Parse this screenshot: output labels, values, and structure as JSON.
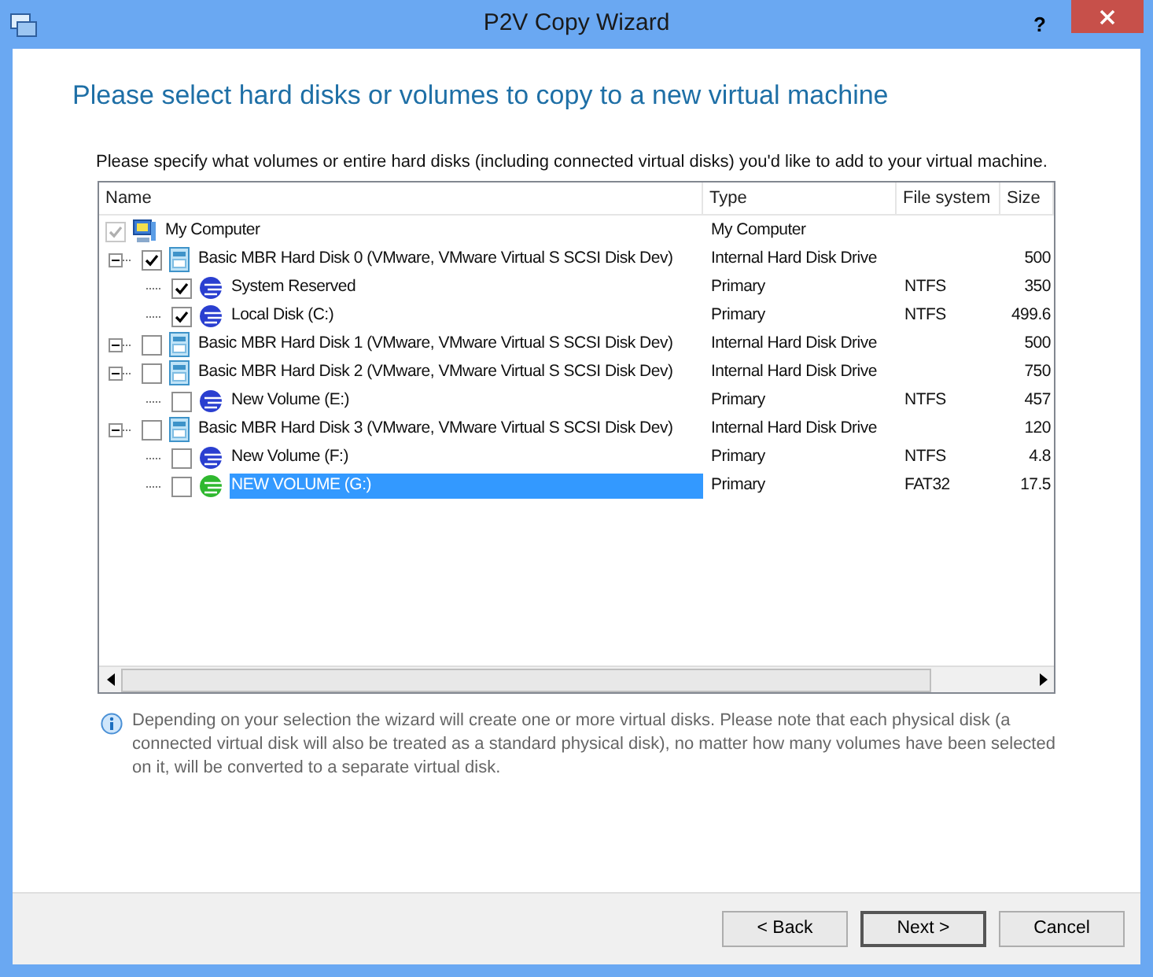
{
  "window": {
    "title": "P2V Copy Wizard",
    "help": "?"
  },
  "heading": "Please select hard disks or volumes to copy to a new virtual machine",
  "instruction": "Please specify what volumes or entire hard disks (including connected virtual disks) you'd like to add to your virtual machine.",
  "table": {
    "columns": [
      "Name",
      "Type",
      "File system",
      "Size"
    ],
    "rows": [
      {
        "kind": "computer",
        "name": "My Computer",
        "type": "My Computer",
        "checked": true,
        "disabled": true,
        "selected": false,
        "children": [
          {
            "kind": "disk",
            "name": "Basic MBR Hard Disk 0 (VMware, VMware Virtual S SCSI Disk Dev)",
            "type": "Internal Hard Disk Drive",
            "size": "500",
            "checked": true,
            "disabled": false,
            "selected": false,
            "children": [
              {
                "kind": "volume",
                "color": "#2a3fd0",
                "name": "System Reserved",
                "type": "Primary",
                "fs": "NTFS",
                "size": "350",
                "checked": true,
                "disabled": false,
                "selected": false
              },
              {
                "kind": "volume",
                "color": "#2a3fd0",
                "name": "Local Disk (C:)",
                "type": "Primary",
                "fs": "NTFS",
                "size": "499.6",
                "checked": true,
                "disabled": false,
                "selected": false
              }
            ]
          },
          {
            "kind": "disk",
            "name": "Basic MBR Hard Disk 1 (VMware, VMware Virtual S SCSI Disk Dev)",
            "type": "Internal Hard Disk Drive",
            "size": "500",
            "checked": false,
            "disabled": false,
            "selected": false
          },
          {
            "kind": "disk",
            "name": "Basic MBR Hard Disk 2 (VMware, VMware Virtual S SCSI Disk Dev)",
            "type": "Internal Hard Disk Drive",
            "size": "750",
            "checked": false,
            "disabled": false,
            "selected": false,
            "children": [
              {
                "kind": "volume",
                "color": "#2a3fd0",
                "name": "New Volume (E:)",
                "type": "Primary",
                "fs": "NTFS",
                "size": "457",
                "checked": false,
                "disabled": false,
                "selected": false
              }
            ]
          },
          {
            "kind": "disk",
            "name": "Basic MBR Hard Disk 3 (VMware, VMware Virtual S SCSI Disk Dev)",
            "type": "Internal Hard Disk Drive",
            "size": "120",
            "checked": false,
            "disabled": false,
            "selected": false,
            "children": [
              {
                "kind": "volume",
                "color": "#2a3fd0",
                "name": "New Volume (F:)",
                "type": "Primary",
                "fs": "NTFS",
                "size": "4.8",
                "checked": false,
                "disabled": false,
                "selected": false
              },
              {
                "kind": "volume",
                "color": "#2fb82f",
                "name": "NEW VOLUME (G:)",
                "type": "Primary",
                "fs": "FAT32",
                "size": "17.5",
                "checked": false,
                "disabled": false,
                "selected": true
              }
            ]
          }
        ]
      }
    ]
  },
  "note": "Depending on your selection the wizard will create one or more virtual disks. Please note that each physical disk (a connected virtual disk will also be treated as a standard physical disk), no matter how many volumes have been selected on it, will be converted to a separate virtual disk.",
  "buttons": [
    {
      "label": "< Back",
      "default": false
    },
    {
      "label": "Next >",
      "default": true
    },
    {
      "label": "Cancel",
      "default": false
    }
  ]
}
